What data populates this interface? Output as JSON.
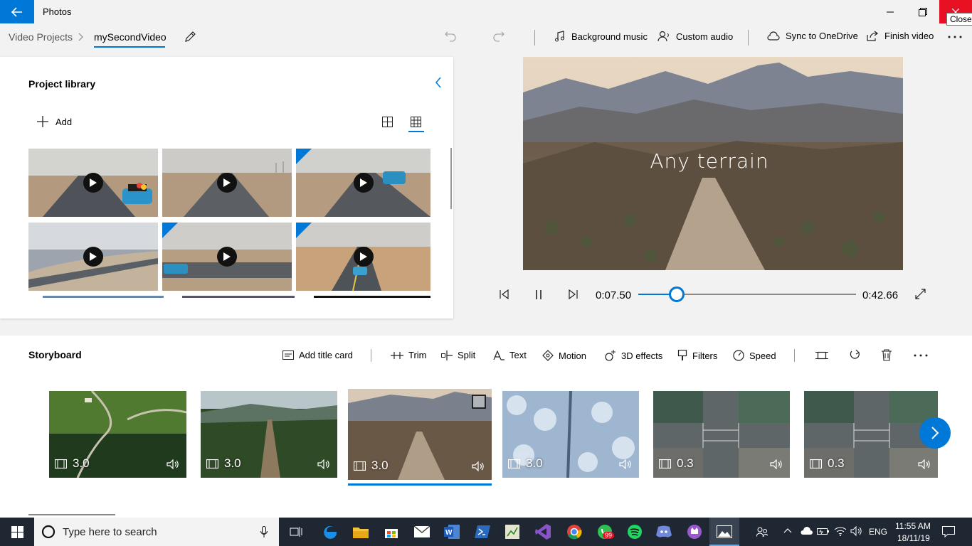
{
  "titlebar": {
    "app_title": "Photos",
    "close_tooltip": "Close",
    "accent": "#0078d7",
    "close_color": "#e81123"
  },
  "breadcrumb": {
    "items": [
      "Video Projects",
      "mySecondVideo"
    ]
  },
  "toolbar": {
    "background_music": "Background music",
    "custom_audio": "Custom audio",
    "sync": "Sync to OneDrive",
    "finish": "Finish video"
  },
  "library": {
    "title": "Project library",
    "add_label": "Add"
  },
  "preview": {
    "caption": "Any terrain"
  },
  "playback": {
    "current_time": "0:07.50",
    "total_time": "0:42.66",
    "progress": 0.176
  },
  "storyboard": {
    "title": "Storyboard",
    "tools": {
      "add_title_card": "Add title card",
      "trim": "Trim",
      "split": "Split",
      "text": "Text",
      "motion": "Motion",
      "effects_3d": "3D effects",
      "filters": "Filters",
      "speed": "Speed"
    },
    "clips": [
      {
        "duration": "3.0",
        "scene": "green-valley"
      },
      {
        "duration": "3.0",
        "scene": "forest-road"
      },
      {
        "duration": "3.0",
        "scene": "terrain-road",
        "selected": true
      },
      {
        "duration": "3.0",
        "scene": "snow-forest"
      },
      {
        "duration": "0.3",
        "scene": "city-intersection"
      },
      {
        "duration": "0.3",
        "scene": "city-intersection"
      }
    ]
  },
  "taskbar": {
    "search_placeholder": "Type here to search",
    "language": "ENG",
    "time": "11:55 AM",
    "date": "18/11/19",
    "whatsapp_badge": "99"
  }
}
